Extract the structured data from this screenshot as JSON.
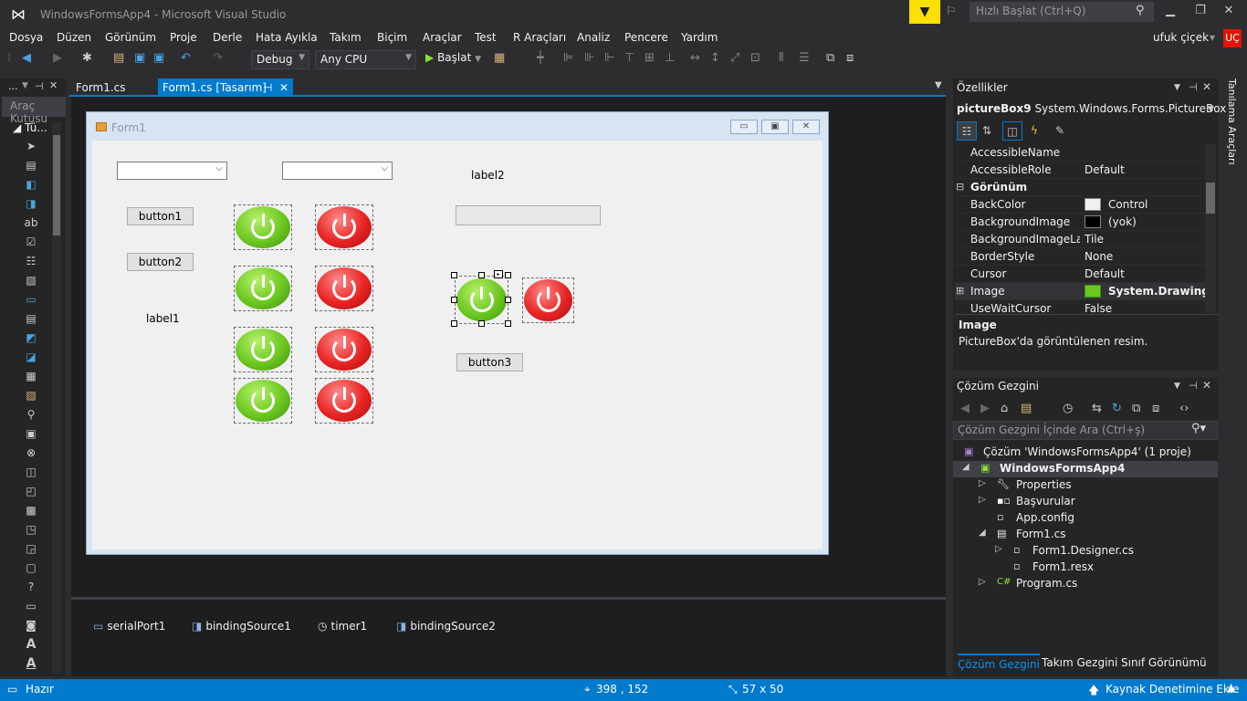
{
  "window": {
    "title": "WindowsFormsApp4 - Microsoft Visual Studio",
    "quick_launch_placeholder": "Hızlı Başlat (Ctrl+Q)",
    "user_name": "ufuk çiçek",
    "user_badge": "UÇ"
  },
  "menu": [
    "Dosya",
    "Düzen",
    "Görünüm",
    "Proje",
    "Derle",
    "Hata Ayıkla",
    "Takım",
    "Biçim",
    "Araçlar",
    "Test",
    "R Araçları",
    "Analiz",
    "Pencere",
    "Yardım"
  ],
  "toolbar": {
    "configuration": "Debug",
    "platform": "Any CPU",
    "start_label": "Başlat"
  },
  "toolbox": {
    "header": "...",
    "title": "Araç Kutusu",
    "group": "◢ Tü..."
  },
  "tabs": {
    "tab1": "Form1.cs",
    "tab2": "Form1.cs [Tasarım]",
    "pin": "⊣",
    "close": "✕"
  },
  "form": {
    "title": "Form1",
    "button1": "button1",
    "button2": "button2",
    "button3": "button3",
    "label1": "label1",
    "label2": "label2"
  },
  "tray": {
    "c1": "serialPort1",
    "c2": "bindingSource1",
    "c3": "timer1",
    "c4": "bindingSource2"
  },
  "properties": {
    "header": "Özellikler",
    "object_name": "pictureBox9",
    "object_type": "System.Windows.Forms.PictureBox",
    "rows": [
      {
        "name": "AccessibleName",
        "value": ""
      },
      {
        "name": "AccessibleRole",
        "value": "Default"
      },
      {
        "name": "Görünüm",
        "value": ""
      },
      {
        "name": "BackColor",
        "value": "Control",
        "swatch": "#f0f0f0"
      },
      {
        "name": "BackgroundImage",
        "value": "(yok)",
        "swatch": "#000000"
      },
      {
        "name": "BackgroundImageLayout",
        "value": "Tile"
      },
      {
        "name": "BorderStyle",
        "value": "None"
      },
      {
        "name": "Cursor",
        "value": "Default"
      },
      {
        "name": "Image",
        "value": "System.Drawing.B"
      },
      {
        "name": "UseWaitCursor",
        "value": "False"
      }
    ],
    "desc_name": "Image",
    "desc_text": "PictureBox'da görüntülenen resim."
  },
  "solution": {
    "header": "Çözüm Gezgini",
    "search_placeholder": "Çözüm Gezgini İçinde Ara (Ctrl+ş)",
    "items": [
      "Çözüm 'WindowsFormsApp4' (1 proje)",
      "WindowsFormsApp4",
      "Properties",
      "Başvurular",
      "App.config",
      "Form1.cs",
      "Form1.Designer.cs",
      "Form1.resx",
      "Program.cs"
    ],
    "tabs": [
      "Çözüm Gezgini",
      "Takım Gezgini",
      "Sınıf Görünümü"
    ]
  },
  "side_tab": "Tanılama Araçları",
  "status": {
    "ready": "Hazır",
    "position": "398 , 152",
    "size": "57 x 50",
    "source_control": "Kaynak Denetimine Ekle"
  },
  "colors": {
    "accent": "#007acc",
    "background": "#2d2d30",
    "filter": "#fce100",
    "badge": "#e51400"
  }
}
